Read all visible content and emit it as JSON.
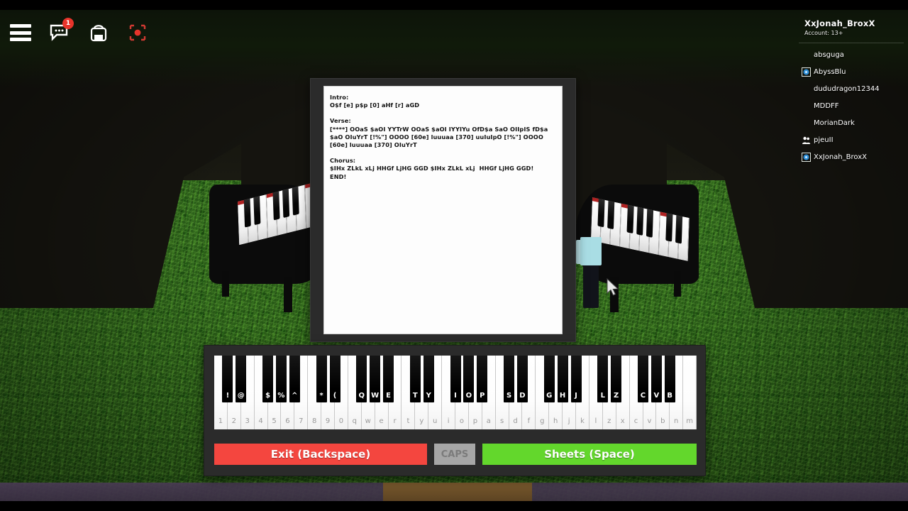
{
  "toolbar": {
    "menu_label": "hamburger-menu",
    "chat_label": "chat",
    "chat_badge": "1",
    "backpack_label": "backpack",
    "record_label": "record"
  },
  "player_panel": {
    "username": "XxJonah_BroxX",
    "account": "Account: 13+",
    "players": [
      {
        "name": "absguga",
        "icon": "none"
      },
      {
        "name": "AbyssBlu",
        "icon": "premium-badge"
      },
      {
        "name": "dududragon12344",
        "icon": "none"
      },
      {
        "name": "MDDFF",
        "icon": "none"
      },
      {
        "name": "MorianDark",
        "icon": "none"
      },
      {
        "name": "pjeuII",
        "icon": "friends-icon"
      },
      {
        "name": "XxJonah_BroxX",
        "icon": "premium-badge"
      }
    ]
  },
  "sheet": {
    "lines": [
      "Intro:",
      "O$f [e] p$p [0] aHf [r] aGD",
      "",
      "Verse:",
      "[****] OOaS $aOI YYTrW OOaS $aOI IYYIYu OfD$a SaO OIIpIS fD$a",
      "$aO OIuYrT [!%\"] OOOO [60e] luuuaa [370] uuIuIpO [!%\"] OOOO",
      "[60e] luuuaa [370] OIuYrT",
      "",
      "Chorus:",
      "$IHx ZLkL xLj HHGf LjHG GGD $IHx ZLkL xLj  HHGf LjHG GGD!",
      "END!"
    ]
  },
  "keyboard": {
    "white_keys": [
      "1",
      "2",
      "3",
      "4",
      "5",
      "6",
      "7",
      "8",
      "9",
      "0",
      "q",
      "w",
      "e",
      "r",
      "t",
      "y",
      "u",
      "i",
      "o",
      "p",
      "a",
      "s",
      "d",
      "f",
      "g",
      "h",
      "j",
      "k",
      "l",
      "z",
      "x",
      "c",
      "v",
      "b",
      "n",
      "m"
    ],
    "black_keys": [
      {
        "label": "!",
        "after": 0
      },
      {
        "label": "@",
        "after": 1
      },
      {
        "label": "$",
        "after": 3
      },
      {
        "label": "%",
        "after": 4
      },
      {
        "label": "^",
        "after": 5
      },
      {
        "label": "*",
        "after": 7
      },
      {
        "label": "(",
        "after": 8
      },
      {
        "label": "Q",
        "after": 10
      },
      {
        "label": "W",
        "after": 11
      },
      {
        "label": "E",
        "after": 12
      },
      {
        "label": "T",
        "after": 14
      },
      {
        "label": "Y",
        "after": 15
      },
      {
        "label": "I",
        "after": 17
      },
      {
        "label": "O",
        "after": 18
      },
      {
        "label": "P",
        "after": 19
      },
      {
        "label": "S",
        "after": 21
      },
      {
        "label": "D",
        "after": 22
      },
      {
        "label": "G",
        "after": 24
      },
      {
        "label": "H",
        "after": 25
      },
      {
        "label": "J",
        "after": 26
      },
      {
        "label": "L",
        "after": 28
      },
      {
        "label": "Z",
        "after": 29
      },
      {
        "label": "C",
        "after": 31
      },
      {
        "label": "V",
        "after": 32
      },
      {
        "label": "B",
        "after": 33
      }
    ],
    "buttons": {
      "exit": "Exit (Backspace)",
      "caps": "CAPS",
      "sheets": "Sheets (Space)"
    }
  },
  "colors": {
    "exit_button": "#f4463f",
    "sheets_button": "#63d72c",
    "caps_button": "#a6a6a6",
    "badge": "#e8342b",
    "grass": "#46852b",
    "panel": "#2b2b2b"
  }
}
